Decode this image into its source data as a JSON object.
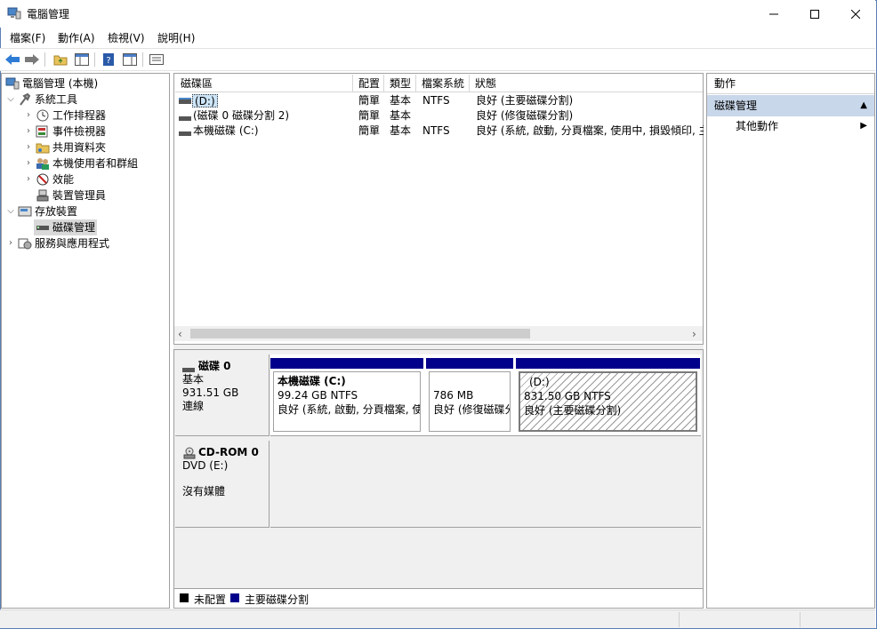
{
  "window": {
    "title": "電腦管理"
  },
  "menu": [
    "檔案(F)",
    "動作(A)",
    "檢視(V)",
    "說明(H)"
  ],
  "tree": {
    "root": "電腦管理 (本機)",
    "system_tools": "系統工具",
    "task_scheduler": "工作排程器",
    "event_viewer": "事件檢視器",
    "shared_folders": "共用資料夾",
    "local_users": "本機使用者和群組",
    "performance": "效能",
    "device_manager": "裝置管理員",
    "storage": "存放裝置",
    "disk_management": "磁碟管理",
    "services": "服務與應用程式"
  },
  "volume_table": {
    "headers": [
      "磁碟區",
      "配置",
      "類型",
      "檔案系統",
      "狀態"
    ],
    "rows": [
      {
        "name": "(D:)",
        "layout": "簡單",
        "type": "基本",
        "fs": "NTFS",
        "status": "良好 (主要磁碟分割)"
      },
      {
        "name": "(磁碟 0 磁碟分割 2)",
        "layout": "簡單",
        "type": "基本",
        "fs": "",
        "status": "良好 (修復磁碟分割)"
      },
      {
        "name": "本機磁碟 (C:)",
        "layout": "簡單",
        "type": "基本",
        "fs": "NTFS",
        "status": "良好 (系統, 啟動, 分頁檔案, 使用中, 損毀傾印, 主要"
      }
    ]
  },
  "disks": {
    "disk0": {
      "name": "磁碟 0",
      "kind": "基本",
      "size": "931.51 GB",
      "state": "連線",
      "partitions": [
        {
          "title": "本機磁碟  (C:)",
          "size": "99.24 GB NTFS",
          "status": "良好 (系統, 啟動, 分頁檔案, 使"
        },
        {
          "title": "",
          "size": "786 MB",
          "status": "良好 (修復磁碟分"
        },
        {
          "title": "(D:)",
          "size": "831.50 GB NTFS",
          "status": "良好 (主要磁碟分割)"
        }
      ]
    },
    "cdrom0": {
      "name": "CD-ROM 0",
      "kind": "DVD (E:)",
      "state": "沒有媒體"
    }
  },
  "legend": {
    "unallocated": "未配置",
    "primary": "主要磁碟分割"
  },
  "actions": {
    "header": "動作",
    "section": "磁碟管理",
    "more": "其他動作"
  },
  "colors": {
    "primary_partition": "#00008b",
    "unallocated": "#000000",
    "selection": "#c8d7ea"
  }
}
